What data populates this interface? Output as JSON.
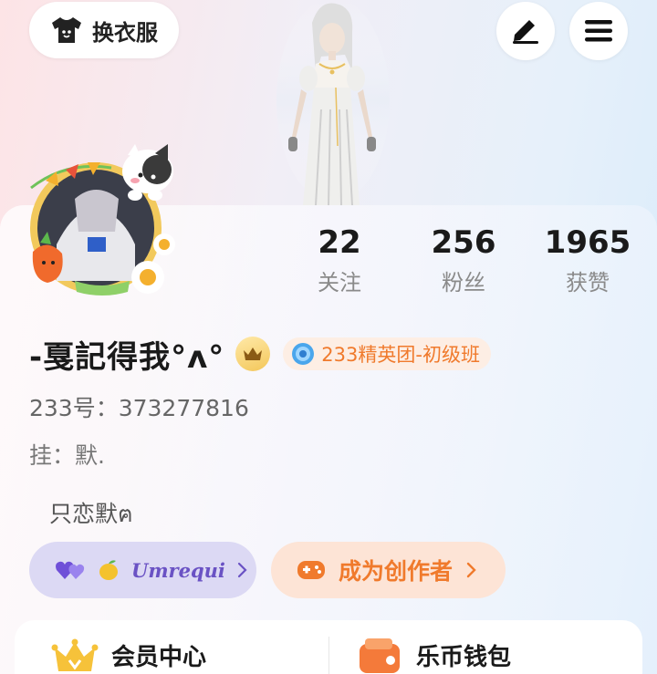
{
  "header": {
    "wardrobe_label": "换衣服",
    "icons": [
      "shirt-icon",
      "edit-icon",
      "menu-icon"
    ]
  },
  "stats": [
    {
      "value": "22",
      "label": "关注"
    },
    {
      "value": "256",
      "label": "粉丝"
    },
    {
      "value": "1965",
      "label": "获赞"
    }
  ],
  "profile": {
    "nickname": "-戛記得我°ʌ°",
    "team_badge": "233精英团-初级班",
    "uid_label": "233号：",
    "uid_value": "373277816",
    "hang": "挂：默.",
    "bio": "只恋默ฅ"
  },
  "cp_pill": {
    "name": "Umrequi"
  },
  "creator_pill": {
    "label": "成为创作者"
  },
  "bottom": {
    "vip_title": "会员中心",
    "wallet_title": "乐币钱包"
  },
  "colors": {
    "accent_orange": "#f07a2c",
    "cp_purple": "#6a52c4",
    "crown_gold": "#f3c75a"
  }
}
